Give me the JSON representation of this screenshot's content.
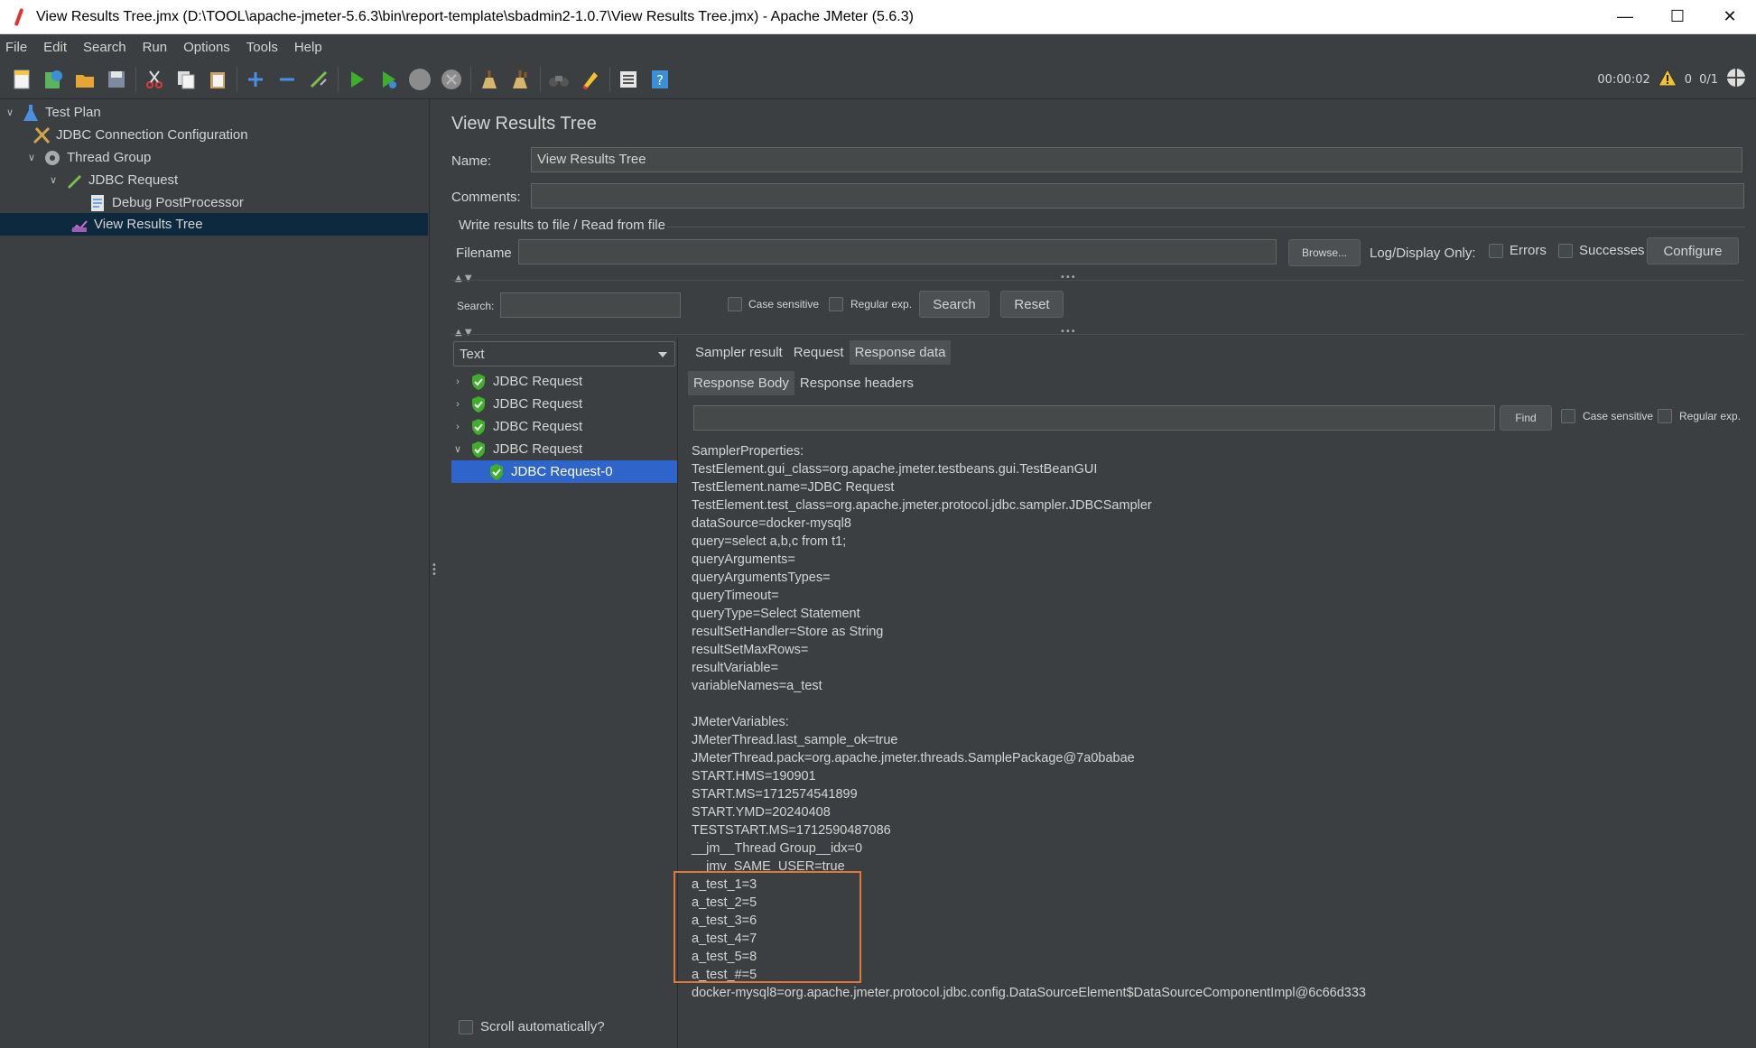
{
  "window": {
    "title": "View Results Tree.jmx (D:\\TOOL\\apache-jmeter-5.6.3\\bin\\report-template\\sbadmin2-1.0.7\\View Results Tree.jmx) - Apache JMeter (5.6.3)",
    "minimize": "—",
    "maximize": "☐",
    "close": "✕"
  },
  "menu": [
    "File",
    "Edit",
    "Search",
    "Run",
    "Options",
    "Tools",
    "Help"
  ],
  "toolbar": {
    "elapsed": "00:00:02",
    "warnings": "0",
    "threads": "0/1"
  },
  "tree": [
    {
      "label": "Test Plan",
      "icon": "flask-icon",
      "expanded": true
    },
    {
      "label": "JDBC Connection Configuration",
      "icon": "wrench-icon"
    },
    {
      "label": "Thread Group",
      "icon": "gear-icon",
      "expanded": true
    },
    {
      "label": "JDBC Request",
      "icon": "pen-icon",
      "expanded": true
    },
    {
      "label": "Debug PostProcessor",
      "icon": "document-icon"
    },
    {
      "label": "View Results Tree",
      "icon": "chart-icon",
      "selected": true
    }
  ],
  "panel": {
    "title": "View Results Tree",
    "name_label": "Name:",
    "name_value": "View Results Tree",
    "comments_label": "Comments:",
    "comments_value": "",
    "file_group_label": "Write results to file / Read from file",
    "filename_label": "Filename",
    "filename_value": "",
    "browse_label": "Browse...",
    "log_display_label": "Log/Display Only:",
    "errors_label": "Errors",
    "successes_label": "Successes",
    "configure_label": "Configure",
    "search_label": "Search:",
    "search_value": "",
    "case_sensitive_label": "Case sensitive",
    "regex_label": "Regular exp.",
    "search_button": "Search",
    "reset_button": "Reset",
    "renderer": "Text",
    "scroll_auto_label": "Scroll automatically?"
  },
  "results": [
    {
      "label": "JDBC Request",
      "expanded": false
    },
    {
      "label": "JDBC Request",
      "expanded": false
    },
    {
      "label": "JDBC Request",
      "expanded": false
    },
    {
      "label": "JDBC Request",
      "expanded": true
    },
    {
      "label": "JDBC Request-0",
      "selected": true
    }
  ],
  "result_tabs": [
    "Sampler result",
    "Request",
    "Response data"
  ],
  "response_tabs": [
    "Response Body",
    "Response headers"
  ],
  "find": {
    "value": "",
    "button": "Find",
    "case_sensitive_label": "Case sensitive",
    "regex_label": "Regular exp."
  },
  "response_lines": [
    "SamplerProperties:",
    "TestElement.gui_class=org.apache.jmeter.testbeans.gui.TestBeanGUI",
    "TestElement.name=JDBC Request",
    "TestElement.test_class=org.apache.jmeter.protocol.jdbc.sampler.JDBCSampler",
    "dataSource=docker-mysql8",
    "query=select a,b,c from t1;",
    "queryArguments=",
    "queryArgumentsTypes=",
    "queryTimeout=",
    "queryType=Select Statement",
    "resultSetHandler=Store as String",
    "resultSetMaxRows=",
    "resultVariable=",
    "variableNames=a_test",
    "",
    "JMeterVariables:",
    "JMeterThread.last_sample_ok=true",
    "JMeterThread.pack=org.apache.jmeter.threads.SamplePackage@7a0babae",
    "START.HMS=190901",
    "START.MS=1712574541899",
    "START.YMD=20240408",
    "TESTSTART.MS=1712590487086",
    "__jm__Thread Group__idx=0",
    "__jmv_SAME_USER=true",
    "a_test_1=3",
    "a_test_2=5",
    "a_test_3=6",
    "a_test_4=7",
    "a_test_5=8",
    "a_test_#=5",
    "docker-mysql8=org.apache.jmeter.protocol.jdbc.config.DataSourceElement$DataSourceComponentImpl@6c66d333"
  ],
  "colors": {
    "background": "#3c3f41",
    "selection": "#0d293e",
    "list_selection": "#2f65ca",
    "highlight_box": "#d97a3b",
    "success_shield": "#3fae2a"
  }
}
